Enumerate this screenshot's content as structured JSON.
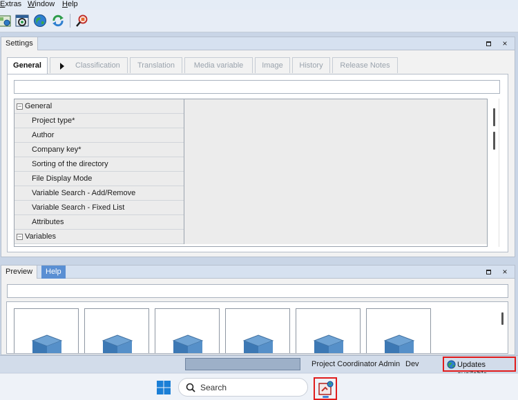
{
  "menu": [
    {
      "label": "Extras",
      "underline": "E",
      "rest": "xtras"
    },
    {
      "label": "Window",
      "underline": "W",
      "rest": "indow"
    },
    {
      "label": "Help",
      "underline": "H",
      "rest": "elp"
    }
  ],
  "toolbar": {
    "icons": [
      "catalog-tree-icon",
      "catalog-settings-icon",
      "globe-icon",
      "refresh-icon",
      "search-catalog-icon"
    ]
  },
  "settings_panel": {
    "title": "Settings",
    "tabs": [
      "General",
      "Classification",
      "Translation",
      "Media variable",
      "Image",
      "History",
      "Release Notes"
    ],
    "active_tab": "General",
    "search_value": "",
    "rows": [
      {
        "label": "General",
        "group": true,
        "expander": "−"
      },
      {
        "label": "Project type*",
        "group": false
      },
      {
        "label": "Author",
        "group": false
      },
      {
        "label": "Company key*",
        "group": false
      },
      {
        "label": "Sorting of the directory",
        "group": false
      },
      {
        "label": "File Display Mode",
        "group": false
      },
      {
        "label": "Variable Search - Add/Remove",
        "group": false
      },
      {
        "label": "Variable Search - Fixed List",
        "group": false
      },
      {
        "label": "Attributes",
        "group": false
      },
      {
        "label": "Variables",
        "group": true,
        "expander": "−"
      }
    ]
  },
  "preview_panel": {
    "tabs": [
      "Preview",
      "Help"
    ],
    "active_tab": "Preview",
    "search_value": "",
    "thumbnail_count": 6
  },
  "panel_buttons": {
    "maximize": "□",
    "close": "×"
  },
  "statusbar": {
    "role": "Project Coordinator",
    "user": "Admin",
    "environment": "Dev",
    "updates_label": "Updates available"
  },
  "taskbar": {
    "search_label": "Search"
  },
  "colors": {
    "accent_tab": "#5a8fd3",
    "highlight_border": "#e11b1b",
    "panel_header": "#d6e1f0"
  }
}
